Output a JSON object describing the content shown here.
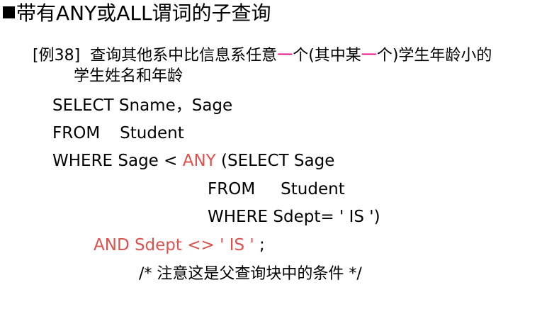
{
  "title": "带有ANY或ALL谓词的子查询",
  "example": {
    "label": "[例38]",
    "line1_pre": "查询其他系中比信息系任意",
    "dash": "一",
    "line1_mid": "个(其中某",
    "line1_post": "个)学生年龄小的",
    "line2": "学生姓名和年龄"
  },
  "code": {
    "select_line": "SELECT Sname，Sage",
    "from_kw": "FROM",
    "from_table": "Student",
    "where_pre": "WHERE Sage < ",
    "any_kw": "ANY",
    "where_post": " (SELECT  Sage",
    "sub_from_kw": "FROM",
    "sub_from_table": "Student",
    "sub_where": "WHERE Sdept= ' IS ')",
    "and_cond": "AND Sdept <> ' IS '",
    "and_end": " ;",
    "comment": "/* 注意这是父查询块中的条件 */"
  },
  "colors": {
    "text": "#000000",
    "accent": "#d9534f",
    "dash_highlight": "#e6007e"
  }
}
